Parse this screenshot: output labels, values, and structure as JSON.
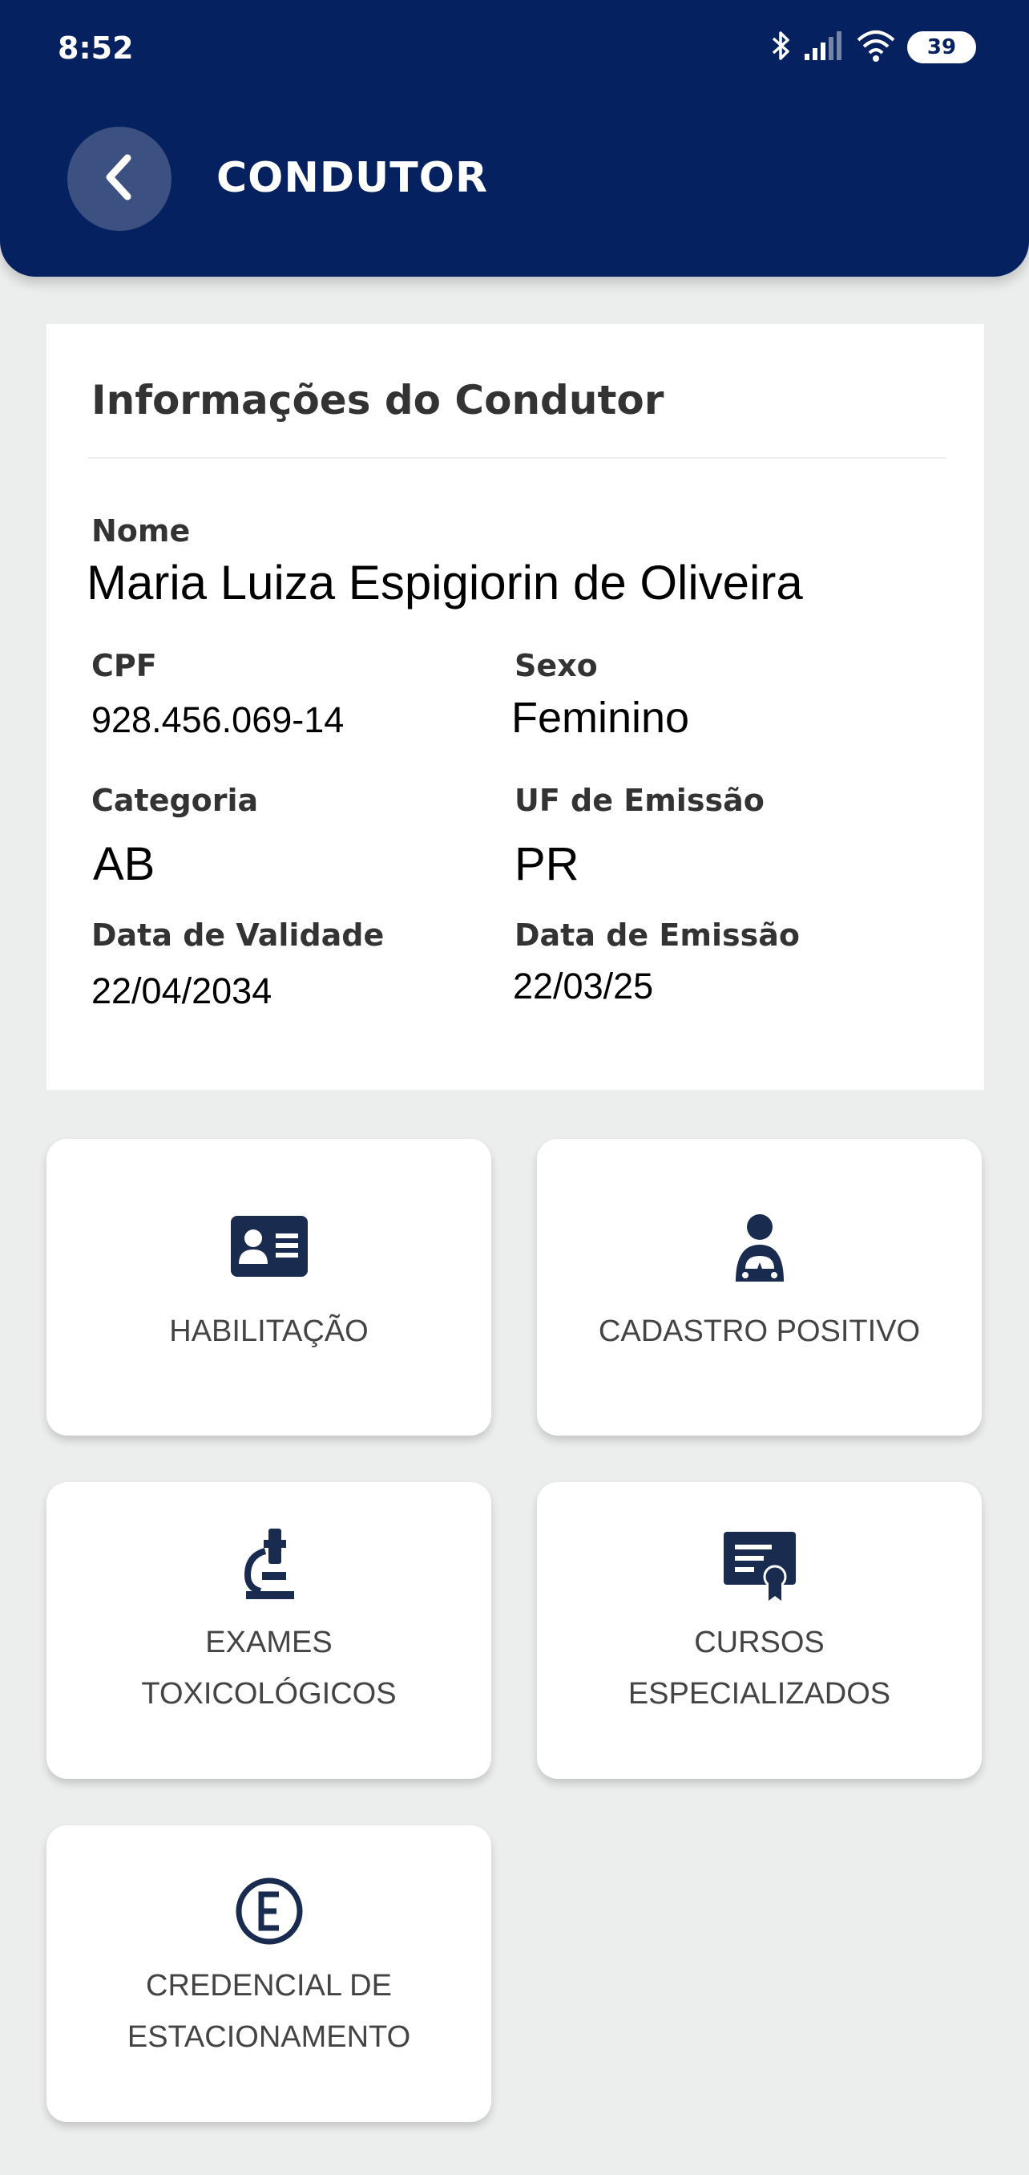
{
  "status_bar": {
    "time": "8:52",
    "battery": "39",
    "icons": [
      "bluetooth-icon",
      "signal-icon",
      "wifi-icon",
      "battery-icon"
    ]
  },
  "header": {
    "title": "CONDUTOR",
    "back_icon": "chevron-left-icon",
    "background": "#06215f"
  },
  "info": {
    "title": "Informações do Condutor",
    "nome_label": "Nome",
    "nome": "Maria Luiza Espigiorin de Oliveira",
    "cpf_label": "CPF",
    "cpf": "928.456.069-14",
    "sexo_label": "Sexo",
    "sexo": "Feminino",
    "categoria_label": "Categoria",
    "categoria": "AB",
    "uf_label": "UF de Emissão",
    "uf": "PR",
    "validade_label": "Data de Validade",
    "validade": "22/04/2034",
    "emissao_label": "Data de Emissão",
    "emissao": "22/03/25"
  },
  "tiles": [
    {
      "icon": "id-card-icon",
      "lines": [
        "HABILITAÇÃO"
      ]
    },
    {
      "icon": "person-stars-icon",
      "lines": [
        "CADASTRO POSITIVO"
      ]
    },
    {
      "icon": "microscope-icon",
      "lines": [
        "EXAMES",
        "TOXICOLÓGICOS"
      ]
    },
    {
      "icon": "certificate-icon",
      "lines": [
        "CURSOS",
        "ESPECIALIZADOS"
      ]
    },
    {
      "icon": "parking-e-icon",
      "lines": [
        "CREDENCIAL DE",
        "ESTACIONAMENTO"
      ]
    }
  ],
  "colors": {
    "icon": "#1a2b50",
    "card": "#ffffff",
    "page": "#eceded"
  }
}
